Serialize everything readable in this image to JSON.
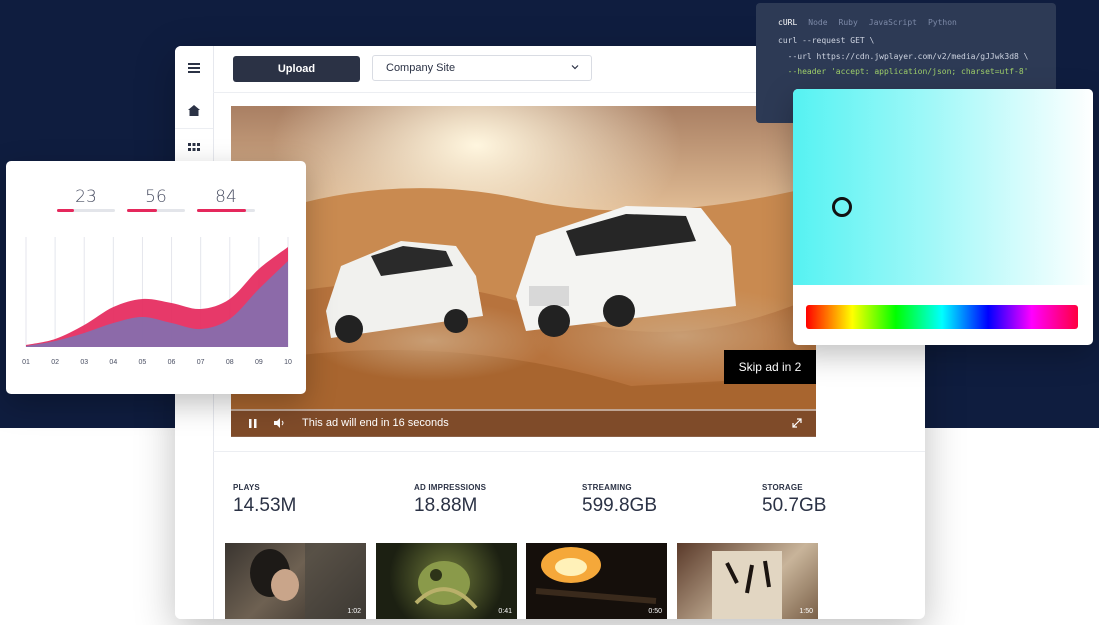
{
  "colors": {
    "navy_bg": "#0f1d3f",
    "accent": "#e5285c",
    "button_dark": "#2b3245"
  },
  "sidebar": {
    "icons": [
      "menu-icon",
      "home-icon",
      "grid-icon"
    ]
  },
  "toolbar": {
    "upload_label": "Upload",
    "site_value": "Company Site"
  },
  "video": {
    "skip_label": "Skip ad in 2",
    "status_text": "This ad will end in 16 seconds",
    "controls": [
      "pause-icon",
      "volume-icon",
      "fullscreen-icon"
    ]
  },
  "stats": [
    {
      "label": "PLAYS",
      "value": "14.53M"
    },
    {
      "label": "AD IMPRESSIONS",
      "value": "18.88M"
    },
    {
      "label": "STREAMING",
      "value": "599.8GB"
    },
    {
      "label": "STORAGE",
      "value": "50.7GB"
    }
  ],
  "thumbnails": [
    {
      "duration": "1:02"
    },
    {
      "duration": "0:41"
    },
    {
      "duration": "0:50"
    },
    {
      "duration": "1:50"
    }
  ],
  "kpis": [
    {
      "value": "23",
      "level": 0.3
    },
    {
      "value": "56",
      "level": 0.52
    },
    {
      "value": "84",
      "level": 0.84
    }
  ],
  "chart_data": {
    "type": "area",
    "categories": [
      "01",
      "02",
      "03",
      "04",
      "05",
      "06",
      "07",
      "08",
      "09",
      "10"
    ],
    "series": [
      {
        "color": "#e5285c",
        "values": [
          2,
          8,
          22,
          40,
          48,
          44,
          38,
          48,
          78,
          100
        ]
      },
      {
        "color": "#7b73b5",
        "values": [
          1,
          6,
          14,
          24,
          30,
          24,
          18,
          28,
          58,
          86
        ]
      }
    ],
    "ylim": [
      0,
      110
    ],
    "grid": "vertical"
  },
  "code": {
    "tabs": [
      "cURL",
      "Node",
      "Ruby",
      "JavaScript",
      "Python"
    ],
    "lines": [
      "curl --request GET \\",
      "  --url https://cdn.jwplayer.com/v2/media/gJJwk3d8 \\",
      "  --header 'accept: application/json; charset=utf-8'"
    ]
  },
  "picker": {
    "selected_color": "#7cf6f6"
  }
}
